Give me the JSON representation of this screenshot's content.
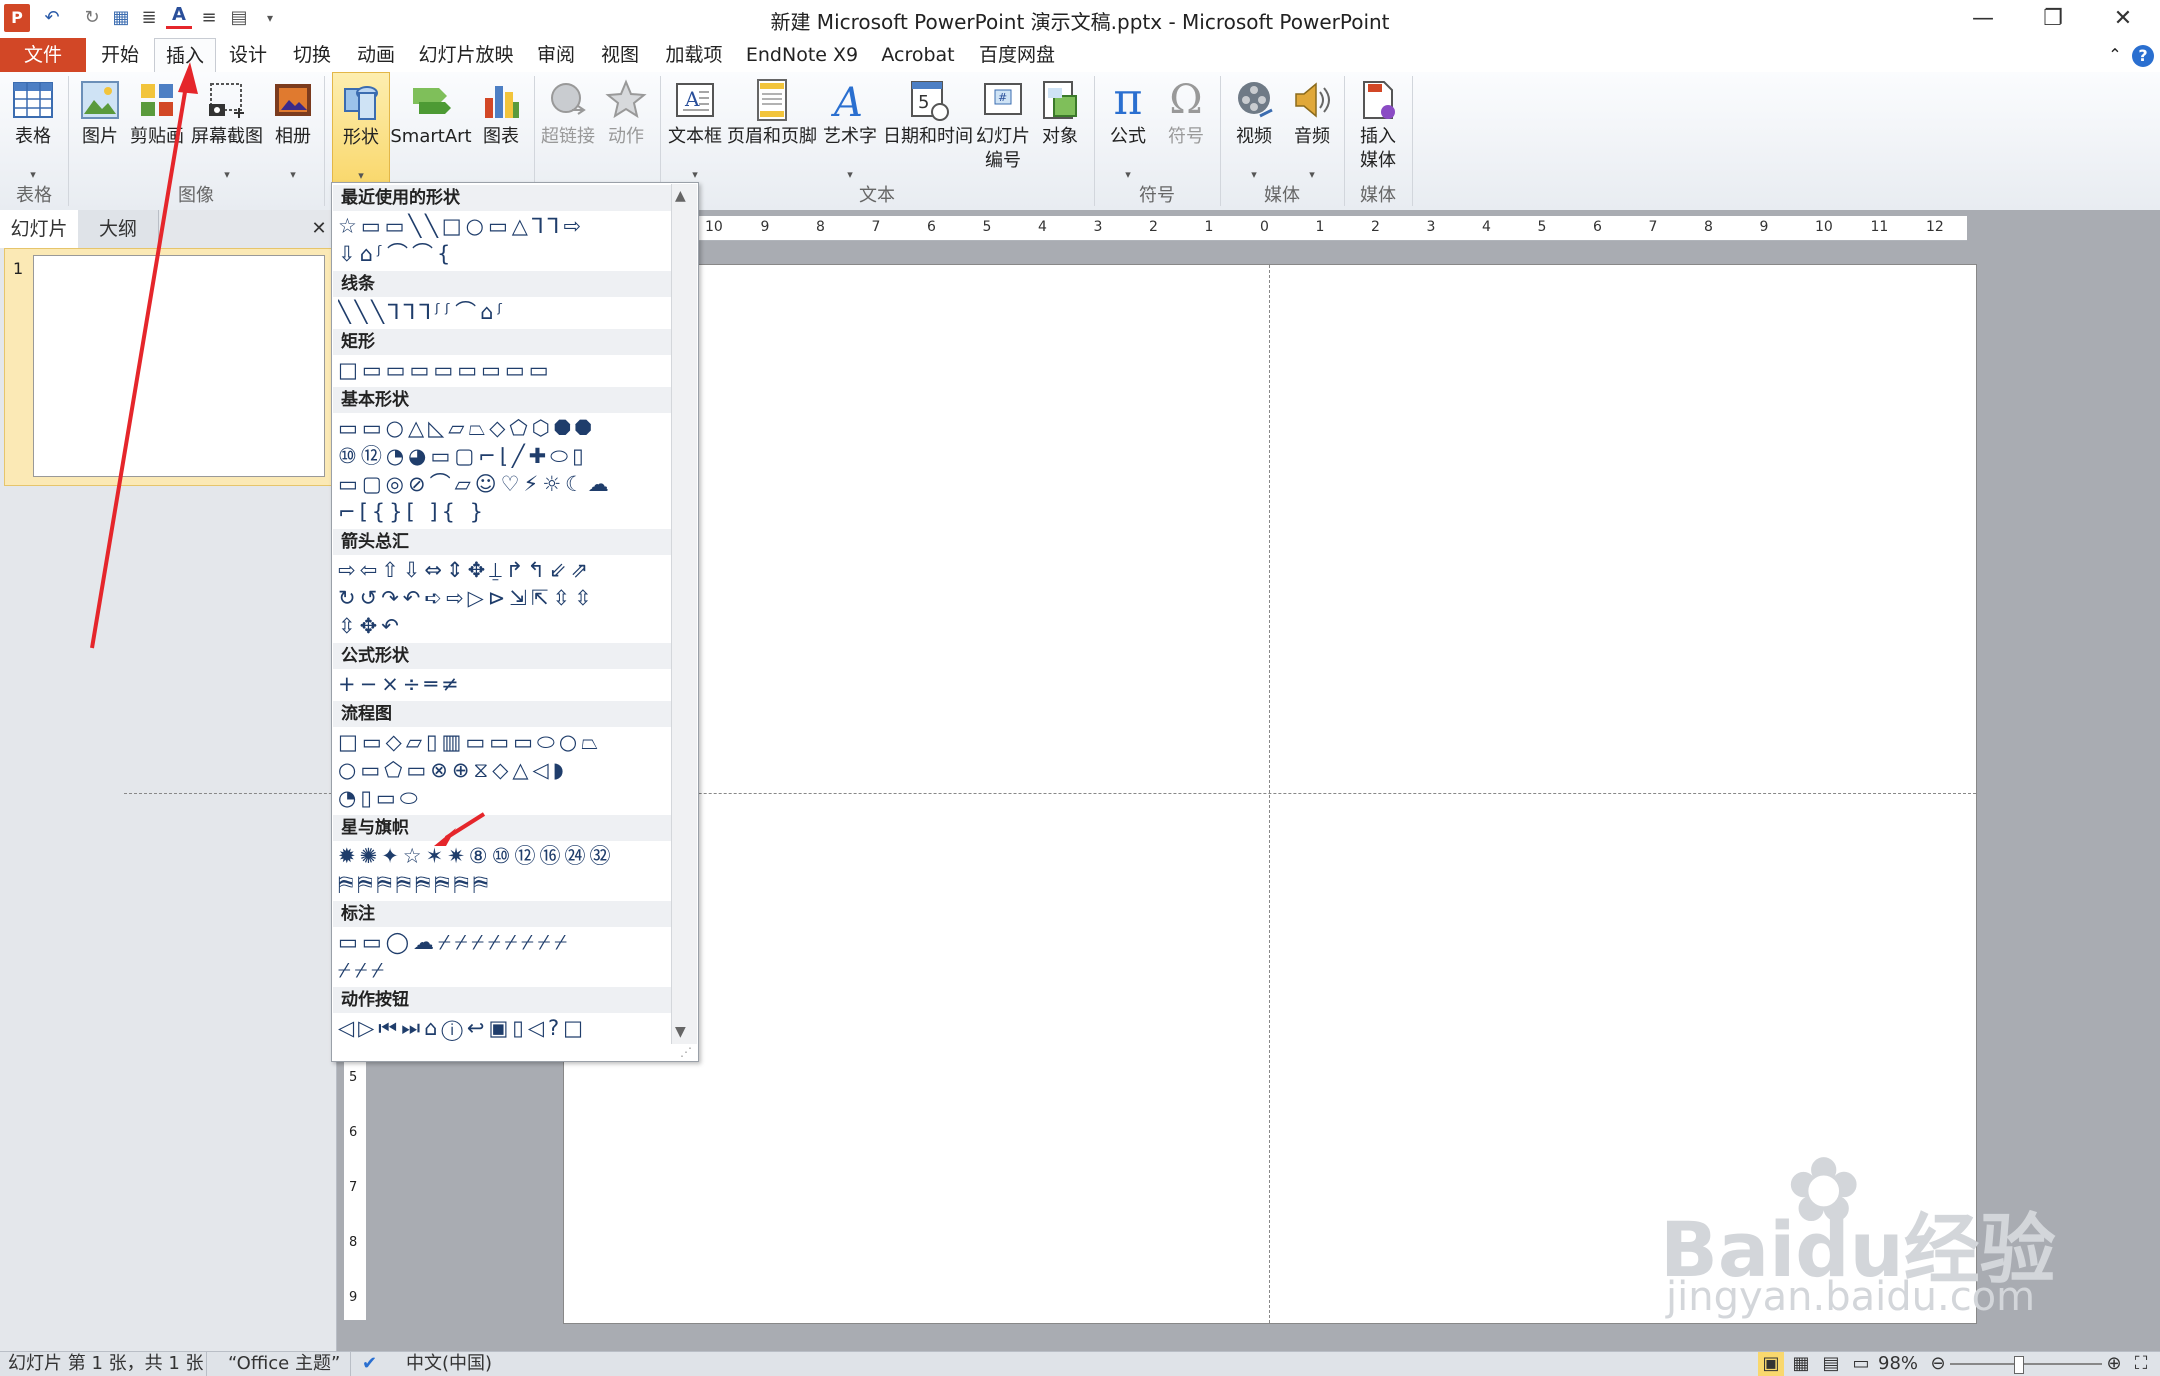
{
  "window": {
    "title": "新建 Microsoft PowerPoint 演示文稿.pptx - Microsoft PowerPoint",
    "minimize_glyph": "—",
    "restore_glyph": "❐",
    "close_glyph": "✕"
  },
  "tabs": {
    "file": "文件",
    "home": "开始",
    "insert": "插入",
    "design": "设计",
    "transitions": "切换",
    "animations": "动画",
    "slideshow": "幻灯片放映",
    "review": "审阅",
    "view": "视图",
    "addins": "加载项",
    "endnote": "EndNote X9",
    "acrobat": "Acrobat",
    "baidu": "百度网盘"
  },
  "ribbon": {
    "table": "表格",
    "picture": "图片",
    "clipart": "剪贴画",
    "screenshot": "屏幕截图",
    "album": "相册",
    "shapes": "形状",
    "smartart": "SmartArt",
    "chart": "图表",
    "hyperlink": "超链接",
    "action": "动作",
    "textbox": "文本框",
    "header_footer": "页眉和页脚",
    "wordart": "艺术字",
    "datetime": "日期和时间",
    "slide_number_1": "幻灯片",
    "slide_number_2": "编号",
    "object": "对象",
    "equation": "公式",
    "symbol": "符号",
    "video": "视频",
    "audio": "音频",
    "insert_media_1": "插入",
    "insert_media_2": "媒体",
    "groups": {
      "tables": "表格",
      "images": "图像",
      "text": "文本",
      "symbols": "符号",
      "media": "媒体",
      "media2": "媒体"
    }
  },
  "left_panel": {
    "tab_slides": "幻灯片",
    "tab_outline": "大纲",
    "close_glyph": "✕",
    "slide_number": "1"
  },
  "gallery": {
    "categories": [
      "最近使用的形状",
      "线条",
      "矩形",
      "基本形状",
      "箭头总汇",
      "公式形状",
      "流程图",
      "星与旗帜",
      "标注",
      "动作按钮"
    ],
    "rows": {
      "recent1": "☆▭▭╲╲□○▭△⅂⅂⇨",
      "recent2": "⇩⌂ᶴ⌒⌒{",
      "lines": "╲╲╲⅂⅂⅂ᶴᶴ⌒⌂ᶴ",
      "rect": "□▭▭▭▭▭▭▭▭",
      "basic1": "▭▭○△◺▱⏢◇⬠⬡⯃⯃",
      "basic2": "⑩⑫◔◕▭▢⌐⌊╱✚⬭▯",
      "basic3": "▭▢◎⊘⌒▱☺♡⚡☼☾☁",
      "basic4": "⌐[{}[ ]{ }",
      "arrows1": "⇨⇦⇧⇩⇔⇕✥⍊↱↰⇙⇗",
      "arrows2": "↻↺↷↶➪⇨▷⊳⇲⇱⇳⇳",
      "arrows3": "⇳✥↶",
      "equation": "+−×÷═≠",
      "flow1": "□▭◇▱▯▥▭▭▭⬭○⏢",
      "flow2": "○▭⬠▭⊗⊕⧖◇△◁◗",
      "flow3": "◔▯▭⬭",
      "stars1": "✹✺✦☆✶✷⑧⑩⑫⑯㉔㉜",
      "stars2": "⛿⛿⛿⛿⛿⛿⛿⛿",
      "callouts1": "▭▭◯☁⌿⌿⌿⌿⌿⌿⌿⌿",
      "callouts2": "⌿⌿⌿",
      "actions": "◁▷⏮⏭⌂ⓘ↩▣▯◁?□"
    }
  },
  "ruler": {
    "h_ticks": [
      "10",
      "9",
      "8",
      "7",
      "6",
      "5",
      "4",
      "3",
      "2",
      "1",
      "0",
      "1",
      "2",
      "3",
      "4",
      "5",
      "6",
      "7",
      "8",
      "9",
      "10",
      "11",
      "12"
    ],
    "v_ticks": [
      "5",
      "6",
      "7",
      "8",
      "9"
    ]
  },
  "status": {
    "slide_info": "幻灯片 第 1 张，共 1 张",
    "theme": "“Office 主题”",
    "language": "中文(中国)",
    "zoom": "98%"
  },
  "watermark": {
    "brand": "Baidu经验",
    "url": "jingyan.baidu.com"
  },
  "colors": {
    "file_tab": "#d24726",
    "annotation_arrow": "#e5262b",
    "shape_stroke": "#1f3d6b"
  }
}
